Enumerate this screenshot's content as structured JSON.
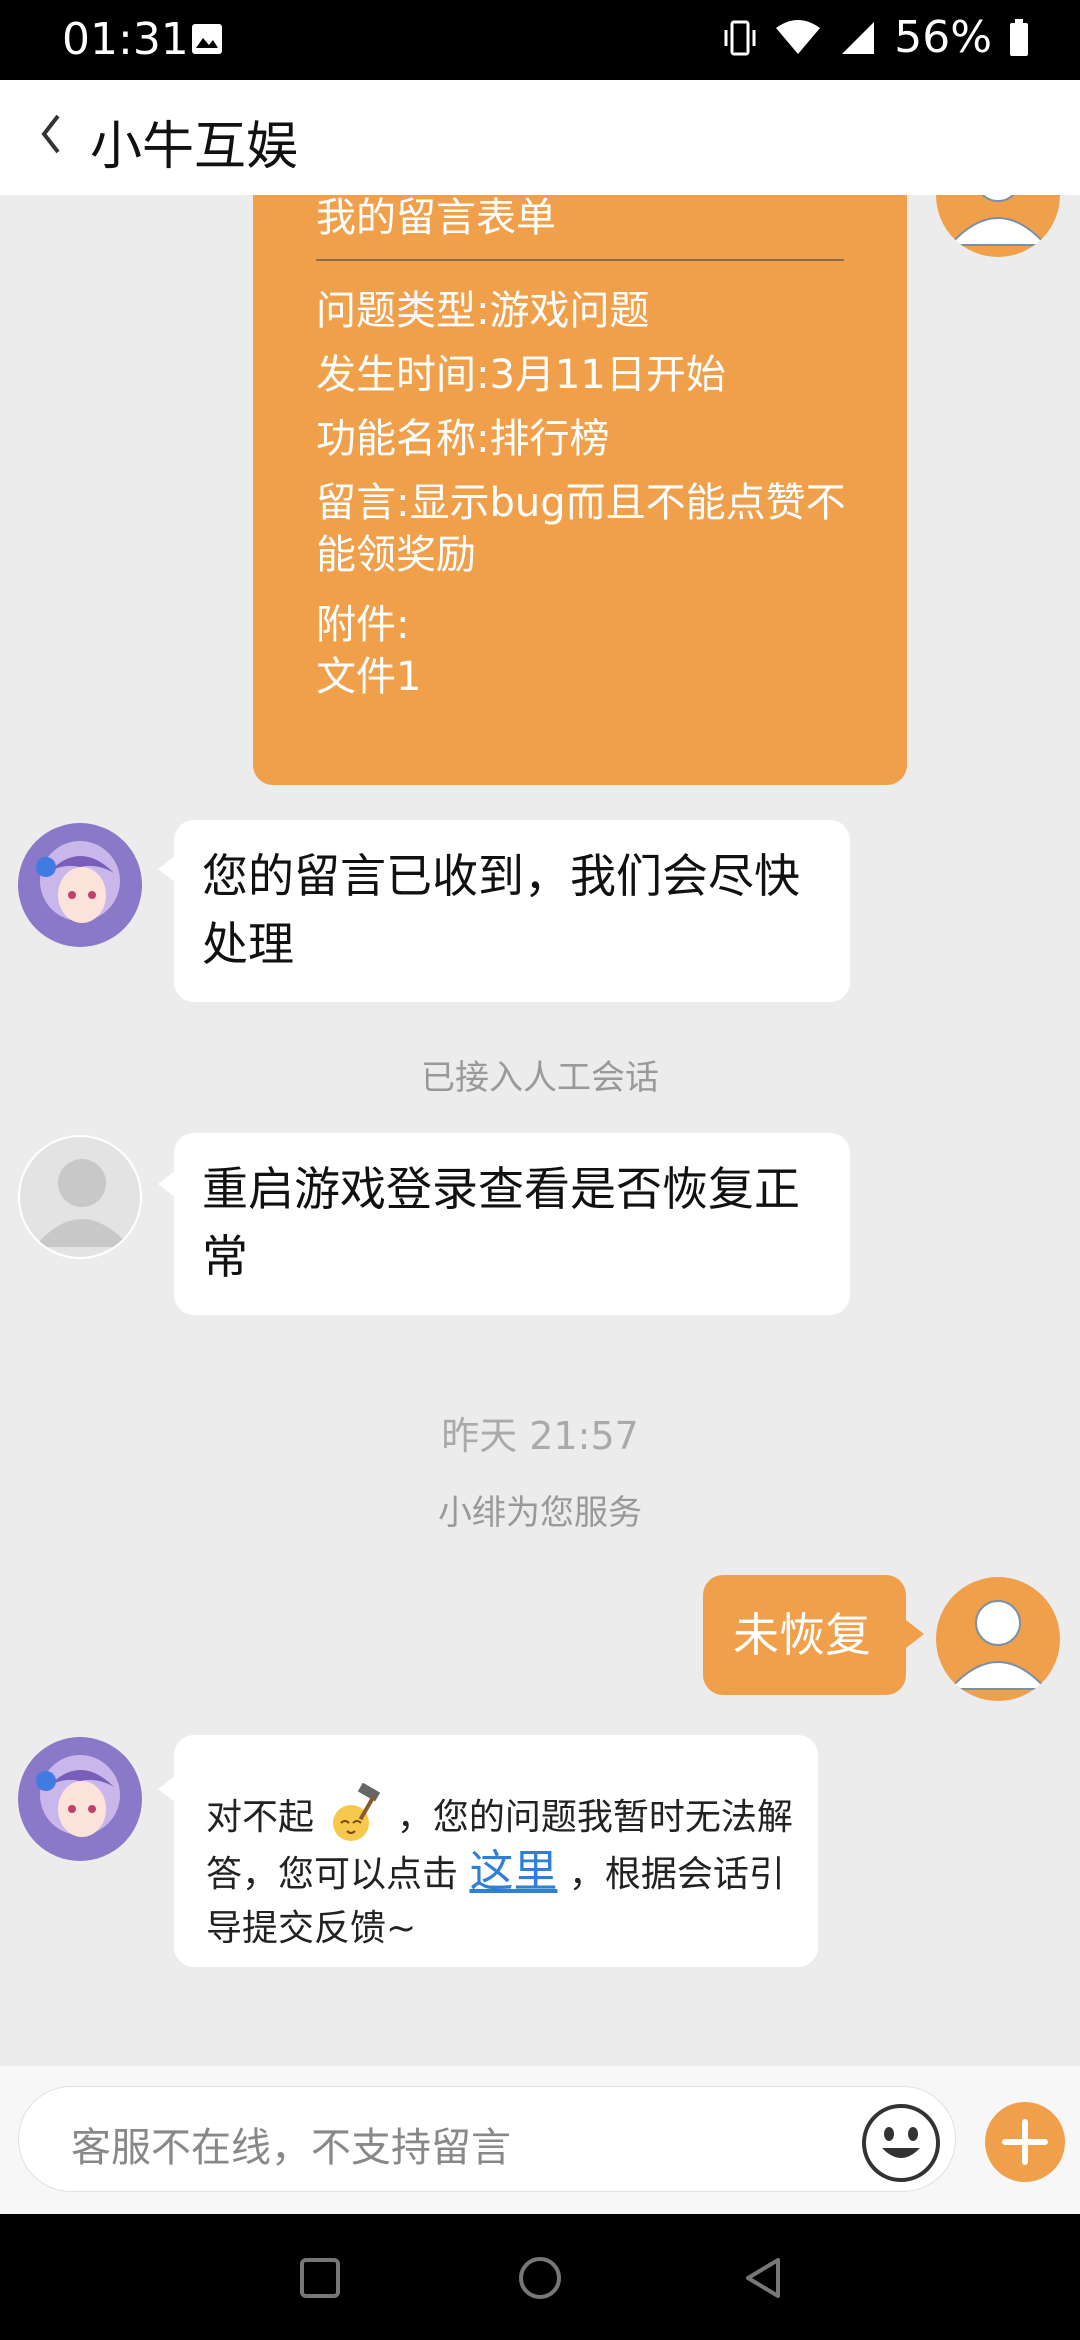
{
  "status": {
    "time": "01:31",
    "battery": "56%"
  },
  "header": {
    "title": "小牛互娱"
  },
  "form": {
    "title": "我的留言表单",
    "lines": [
      "问题类型:游戏问题",
      "发生时间:3月11日开始",
      "功能名称:排行榜",
      "留言:显示bug而且不能点赞不能领奖励",
      "附件:",
      "文件1"
    ]
  },
  "messages": {
    "bot_received": "您的留言已收到，我们会尽快处理",
    "system_transfer": "已接入人工会话",
    "agent_restart": "重启游戏登录查看是否恢复正常",
    "timestamp": "昨天 21:57",
    "system_service": "小绯为您服务",
    "user_reply": "未恢复",
    "bot_sorry_prefix": "对不起",
    "bot_sorry_mid": "，您的问题我暂时无法解答，您可以点击",
    "bot_sorry_link": "这里",
    "bot_sorry_suffix": "，根据会话引导提交反馈~"
  },
  "input": {
    "placeholder": "客服不在线，不支持留言"
  },
  "colors": {
    "accent": "#f0a04b",
    "link": "#2f7fd6",
    "background": "#ececec"
  },
  "icons": [
    "back-chevron-icon",
    "image-icon",
    "vibrate-icon",
    "wifi-icon",
    "signal-icon",
    "battery-icon",
    "user-avatar-icon",
    "emoji-icon",
    "plus-icon",
    "nav-square-icon",
    "nav-circle-icon",
    "nav-back-icon"
  ]
}
